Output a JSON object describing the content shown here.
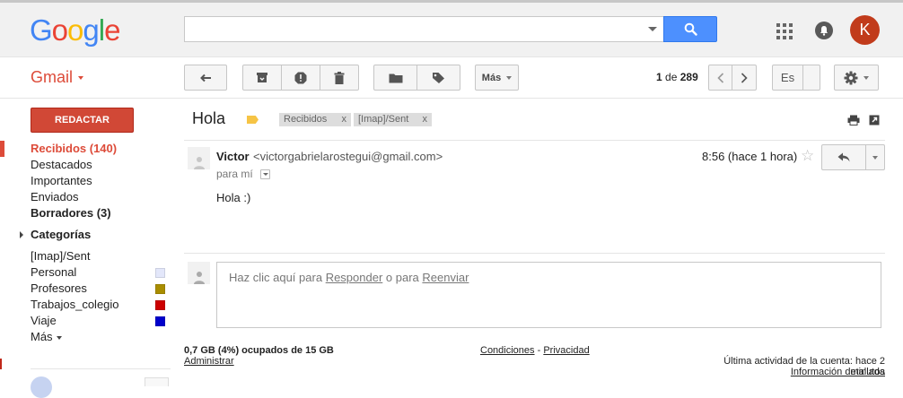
{
  "header": {
    "logo_letters": [
      {
        "ch": "G",
        "color": "#4285f4"
      },
      {
        "ch": "o",
        "color": "#ea4335"
      },
      {
        "ch": "o",
        "color": "#fbbc05"
      },
      {
        "ch": "g",
        "color": "#4285f4"
      },
      {
        "ch": "l",
        "color": "#34a853"
      },
      {
        "ch": "e",
        "color": "#ea4335"
      }
    ],
    "search_value": "",
    "avatar_initial": "K",
    "icons": [
      "search-icon",
      "apps-icon",
      "notifications-icon"
    ]
  },
  "toolbar": {
    "app_label": "Gmail",
    "more_label": "Más",
    "pager_current": "1",
    "pager_of": "de",
    "pager_total": "289",
    "input_tools_label": "Es",
    "icons": [
      "back-icon",
      "archive-icon",
      "report-spam-icon",
      "delete-icon",
      "move-to-folder-icon",
      "label-icon",
      "older-icon",
      "newer-icon",
      "settings-gear-icon"
    ]
  },
  "sidebar": {
    "compose_label": "REDACTAR",
    "items": [
      {
        "label": "Recibidos (140)"
      },
      {
        "label": "Destacados"
      },
      {
        "label": "Importantes"
      },
      {
        "label": "Enviados"
      },
      {
        "label": "Borradores (3)"
      }
    ],
    "categories_label": "Categorías",
    "labels": [
      {
        "label": "[Imap]/Sent",
        "color": ""
      },
      {
        "label": "Personal",
        "color": "#e3e7fa"
      },
      {
        "label": "Profesores",
        "color": "#a98d00"
      },
      {
        "label": "Trabajos_colegio",
        "color": "#cc0000"
      },
      {
        "label": "Viaje",
        "color": "#0000cc"
      }
    ],
    "more_label": "Más"
  },
  "thread": {
    "subject": "Hola",
    "chips": [
      {
        "label": "Recibidos",
        "remove": "x"
      },
      {
        "label": "[Imap]/Sent",
        "remove": "x"
      }
    ],
    "message": {
      "sender_name": "Victor",
      "sender_email": "<victorgabrielarostegui@gmail.com>",
      "recipients": "para mí",
      "time": "8:56 (hace 1 hora)",
      "body": "Hola :)"
    },
    "reply_prompt": {
      "prefix": "Haz clic aquí para",
      "reply_link": "Responder",
      "middle": "o para",
      "forward_link": "Reenviar"
    }
  },
  "footer": {
    "storage": "0,7 GB (4%) ocupados de 15 GB",
    "admin_link": "Administrar",
    "terms_link": "Condiciones",
    "separator": "-",
    "privacy_link": "Privacidad",
    "last_activity": "Última actividad de la cuenta: hace 2 minutos",
    "details_link": "Información detallada"
  }
}
